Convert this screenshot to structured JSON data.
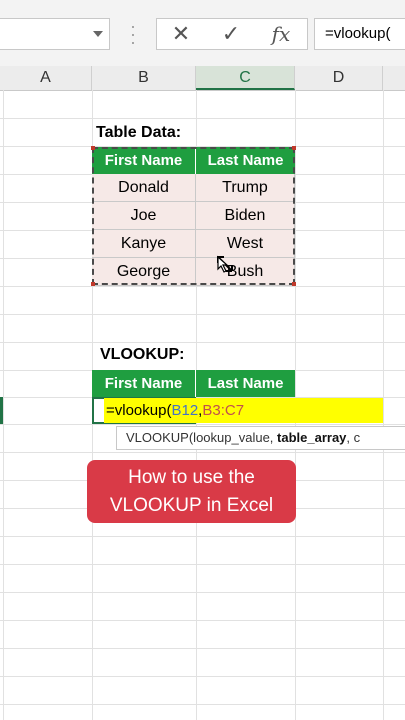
{
  "formula_bar": {
    "cancel_icon": "cancel-x-icon",
    "enter_icon": "checkmark-icon",
    "fx_label": "fx",
    "content": "=vlookup("
  },
  "columns": [
    "A",
    "B",
    "C",
    "D"
  ],
  "table_data": {
    "title": "Table Data:",
    "headers": [
      "First Name",
      "Last Name"
    ],
    "rows": [
      [
        "Donald",
        "Trump"
      ],
      [
        "Joe",
        "Biden"
      ],
      [
        "Kanye",
        "West"
      ],
      [
        "George",
        "Bush"
      ]
    ]
  },
  "vlookup_section": {
    "title": "VLOOKUP:",
    "headers": [
      "First Name",
      "Last Name"
    ],
    "formula_prefix": "=vlookup(",
    "formula_ref1": "B12",
    "formula_sep": ",",
    "formula_ref2": "B3:C7"
  },
  "tooltip": {
    "func": "VLOOKUP(lookup_value, ",
    "bold_arg": "table_array",
    "tail": ", c"
  },
  "caption": {
    "line1": "How to use the",
    "line2": "VLOOKUP in Excel"
  },
  "colors": {
    "header_green": "#1f9e40",
    "row_fill": "#f6e9e7",
    "edit_yellow": "#ffff00",
    "caption_red": "#d93a47"
  }
}
